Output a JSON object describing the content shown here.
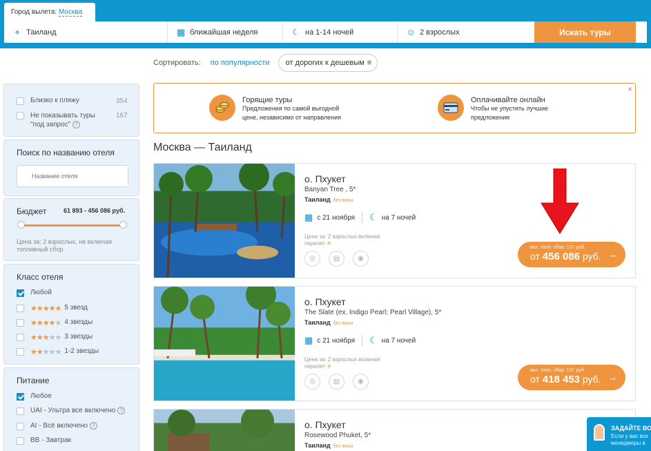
{
  "header": {
    "city_label": "Город вылета:",
    "city_value": "Москва",
    "fields": [
      "Таиланд",
      "ближайшая неделя",
      "на 1-14 ночей",
      "2 взрослых"
    ],
    "search_button": "Искать туры"
  },
  "sort": {
    "label": "Сортировать:",
    "popularity": "по популярности",
    "price": "от дорогих к дешевым"
  },
  "filters": {
    "extra": [
      {
        "label": "Близко к пляжу",
        "count": "354"
      },
      {
        "label": "Не показывать туры",
        "label2": "\"под запрос\"",
        "count": "167"
      }
    ],
    "hotel_search": {
      "title": "Поиск по названию отеля",
      "placeholder": "Название отеля"
    },
    "budget": {
      "title": "Бюджет",
      "range": "61 893 - 456 086 руб.",
      "note": "Цена за: 2 взрослых, не включая топливный сбор",
      "low_fraction": 0,
      "high_fraction": 1
    },
    "hotel_class": {
      "title": "Класс отеля",
      "items": [
        {
          "label": "Любой",
          "checked": true,
          "stars": 0
        },
        {
          "label": "5 звезд",
          "checked": false,
          "stars": 5
        },
        {
          "label": "4 звезды",
          "checked": false,
          "stars": 4
        },
        {
          "label": "3 звезды",
          "checked": false,
          "stars": 3
        },
        {
          "label": "1-2 звезды",
          "checked": false,
          "stars": 2
        }
      ]
    },
    "food": {
      "title": "Питание",
      "items": [
        {
          "label": "Любое",
          "checked": true
        },
        {
          "label": "UAI - Ультра все включено",
          "checked": false
        },
        {
          "label": "AI - Всё включено",
          "checked": false
        },
        {
          "label": "BB - Завтрак",
          "checked": false
        }
      ]
    }
  },
  "promo": {
    "items": [
      {
        "title": "Горящие туры",
        "text1": "Предложения по самой выгодной",
        "text2": "цене, независимо от направления"
      },
      {
        "title": "Оплачивайте онлайн",
        "text1": "Чтобы не упустить лучшие",
        "text2": "предложения"
      }
    ],
    "close": "×"
  },
  "section_title": "Москва — Таиланд",
  "hotels": [
    {
      "place": "о. Пхукет",
      "name": "Banyan Tree , 5*",
      "country": "Таиланд",
      "visa": "без визы",
      "date": "с 21 ноября",
      "nights": "на 7 ночей",
      "note1": "Цена за: 2 взрослых включая",
      "note2": "перелет",
      "fee": "вкл. топл. сбор: 137 руб.",
      "price_prefix": "от",
      "price": "456 086",
      "currency": "руб."
    },
    {
      "place": "о. Пхукет",
      "name": "The Slate (ex. Indigo Pearl; Pearl Village), 5*",
      "country": "Таиланд",
      "visa": "без визы",
      "date": "с 21 ноября",
      "nights": "на 7 ночей",
      "note1": "Цена за: 2 взрослых включая",
      "note2": "перелет",
      "fee": "вкл. топл. сбор: 137 руб.",
      "price_prefix": "от",
      "price": "418 453",
      "currency": "руб."
    },
    {
      "place": "о. Пхукет",
      "name": "Rosewood Phuket, 5*",
      "country": "Таиланд",
      "visa": "без визы"
    }
  ],
  "chat": {
    "title": "ЗАДАЙТЕ ВО",
    "text1": "Если у вас воз",
    "text2": "менеджеры в"
  },
  "colors": {
    "header_blue": "#0e97d1",
    "accent_orange": "#f0953f",
    "link_blue": "#1d8ac0",
    "sidebar_bg": "#e9f2fa",
    "arrow_red": "#e8141c"
  }
}
